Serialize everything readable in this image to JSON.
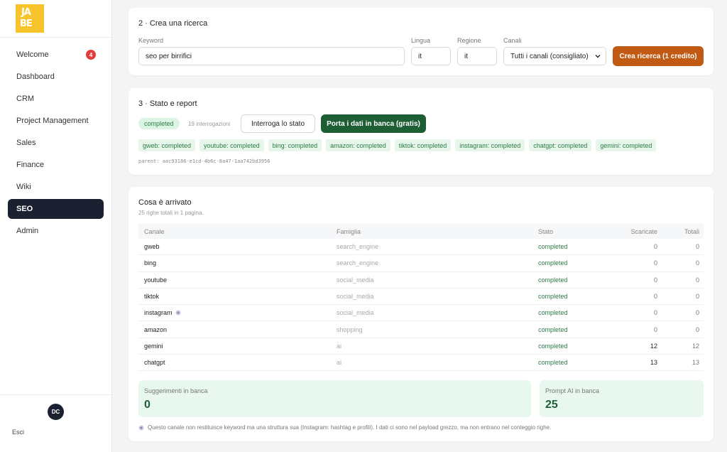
{
  "logo": {
    "letters": [
      "JA",
      "BE"
    ]
  },
  "sidebar": {
    "items": [
      {
        "label": "Welcome",
        "badge": "4"
      },
      {
        "label": "Dashboard"
      },
      {
        "label": "CRM"
      },
      {
        "label": "Project Management"
      },
      {
        "label": "Sales"
      },
      {
        "label": "Finance"
      },
      {
        "label": "Wiki"
      },
      {
        "label": "SEO",
        "active": true
      },
      {
        "label": "Admin"
      }
    ],
    "avatar": "DC",
    "logout": "Esci"
  },
  "create": {
    "title": "2 · Crea una ricerca",
    "keyword_label": "Keyword",
    "keyword_value": "seo per birrifici",
    "lingua_label": "Lingua",
    "lingua_value": "it",
    "regione_label": "Regione",
    "regione_value": "it",
    "canali_label": "Canali",
    "canali_value": "Tutti i canali (consigliato)",
    "submit": "Crea ricerca (1 credito)"
  },
  "status": {
    "title": "3 · Stato e report",
    "state": "completed",
    "queries": "19 interrogazioni",
    "poll_button": "Interroga lo stato",
    "bank_button": "Porta i dati in banca (gratis)",
    "channels": [
      "gweb: completed",
      "youtube: completed",
      "bing: completed",
      "amazon: completed",
      "tiktok: completed",
      "instagram: completed",
      "chatgpt: completed",
      "gemini: completed"
    ],
    "parent": "parent: aac93186-e1cd-4b6c-8a47-1aa742bd3956"
  },
  "results": {
    "title": "Cosa è arrivato",
    "subtitle": "25 righe totali in 1 pagina.",
    "columns": [
      "Canale",
      "Famiglia",
      "Stato",
      "Scaricate",
      "Totali"
    ],
    "rows": [
      {
        "canale": "gweb",
        "famiglia": "search_engine",
        "stato": "completed",
        "scaricate": "0",
        "totali": "0"
      },
      {
        "canale": "bing",
        "famiglia": "search_engine",
        "stato": "completed",
        "scaricate": "0",
        "totali": "0"
      },
      {
        "canale": "youtube",
        "famiglia": "social_media",
        "stato": "completed",
        "scaricate": "0",
        "totali": "0"
      },
      {
        "canale": "tiktok",
        "famiglia": "social_media",
        "stato": "completed",
        "scaricate": "0",
        "totali": "0"
      },
      {
        "canale": "instagram",
        "famiglia": "social_media",
        "stato": "completed",
        "scaricate": "0",
        "totali": "0",
        "info": true
      },
      {
        "canale": "amazon",
        "famiglia": "shopping",
        "stato": "completed",
        "scaricate": "0",
        "totali": "0"
      },
      {
        "canale": "gemini",
        "famiglia": "ai",
        "stato": "completed",
        "scaricate": "12",
        "totali": "12"
      },
      {
        "canale": "chatgpt",
        "famiglia": "ai",
        "stato": "completed",
        "scaricate": "13",
        "totali": "13"
      }
    ],
    "stats": [
      {
        "label": "Suggerimenti in banca",
        "value": "0"
      },
      {
        "label": "Prompt AI in banca",
        "value": "25"
      }
    ],
    "footnote": "Questo canale non restituisce keyword ma una struttura sua (Instagram: hashtag e profili). I dati ci sono nel payload grezzo, ma non entrano nel conteggio righe."
  },
  "colors": {
    "accent_orange": "#c15a13",
    "accent_green": "#1e5e35",
    "sidebar_active": "#1b2130",
    "badge_red": "#e23d3d",
    "logo_yellow": "#f7c52b"
  }
}
